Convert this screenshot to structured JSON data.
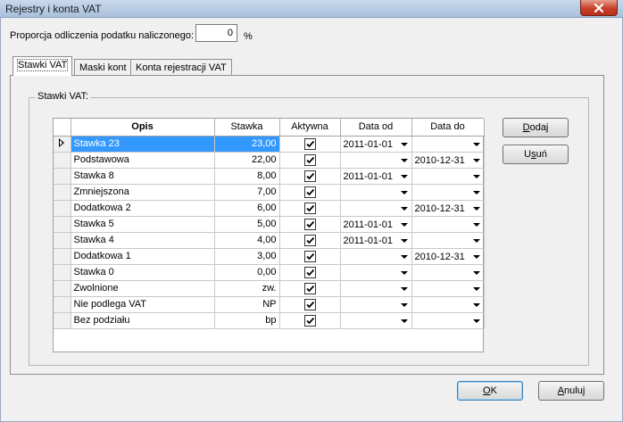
{
  "window": {
    "title": "Rejestry i konta VAT"
  },
  "proportion": {
    "label": "Proporcja odliczenia podatku naliczonego:",
    "value": "0",
    "unit": "%"
  },
  "tabs": [
    {
      "label": "Stawki VAT",
      "active": true
    },
    {
      "label": "Maski kont",
      "active": false
    },
    {
      "label": "Konta rejestracji VAT",
      "active": false
    }
  ],
  "group": {
    "legend": "Stawki VAT:"
  },
  "grid": {
    "columns": {
      "opis": "Opis",
      "stawka": "Stawka",
      "aktywna": "Aktywna",
      "data_od": "Data od",
      "data_do": "Data do"
    },
    "rows": [
      {
        "opis": "Stawka 23",
        "stawka": "23,00",
        "aktywna": true,
        "data_od": "2011-01-01",
        "data_do": "",
        "selected": true
      },
      {
        "opis": "Podstawowa",
        "stawka": "22,00",
        "aktywna": true,
        "data_od": "",
        "data_do": "2010-12-31"
      },
      {
        "opis": "Stawka 8",
        "stawka": "8,00",
        "aktywna": true,
        "data_od": "2011-01-01",
        "data_do": ""
      },
      {
        "opis": "Zmniejszona",
        "stawka": "7,00",
        "aktywna": true,
        "data_od": "",
        "data_do": ""
      },
      {
        "opis": "Dodatkowa 2",
        "stawka": "6,00",
        "aktywna": true,
        "data_od": "",
        "data_do": "2010-12-31"
      },
      {
        "opis": "Stawka 5",
        "stawka": "5,00",
        "aktywna": true,
        "data_od": "2011-01-01",
        "data_do": ""
      },
      {
        "opis": "Stawka 4",
        "stawka": "4,00",
        "aktywna": true,
        "data_od": "2011-01-01",
        "data_do": ""
      },
      {
        "opis": "Dodatkowa 1",
        "stawka": "3,00",
        "aktywna": true,
        "data_od": "",
        "data_do": "2010-12-31"
      },
      {
        "opis": "Stawka 0",
        "stawka": "0,00",
        "aktywna": true,
        "data_od": "",
        "data_do": ""
      },
      {
        "opis": "Zwolnione",
        "stawka": "zw.",
        "aktywna": true,
        "data_od": "",
        "data_do": ""
      },
      {
        "opis": "Nie podlega VAT",
        "stawka": "NP",
        "aktywna": true,
        "data_od": "",
        "data_do": ""
      },
      {
        "opis": "Bez podziału",
        "stawka": "bp",
        "aktywna": true,
        "data_od": "",
        "data_do": ""
      }
    ]
  },
  "buttons": {
    "dodaj": {
      "pre": "",
      "ul": "D",
      "post": "odaj"
    },
    "usun": {
      "pre": "U",
      "ul": "s",
      "post": "uń"
    },
    "ok": {
      "pre": "",
      "ul": "O",
      "post": "K"
    },
    "anuluj": {
      "pre": "",
      "ul": "A",
      "post": "nuluj"
    }
  }
}
